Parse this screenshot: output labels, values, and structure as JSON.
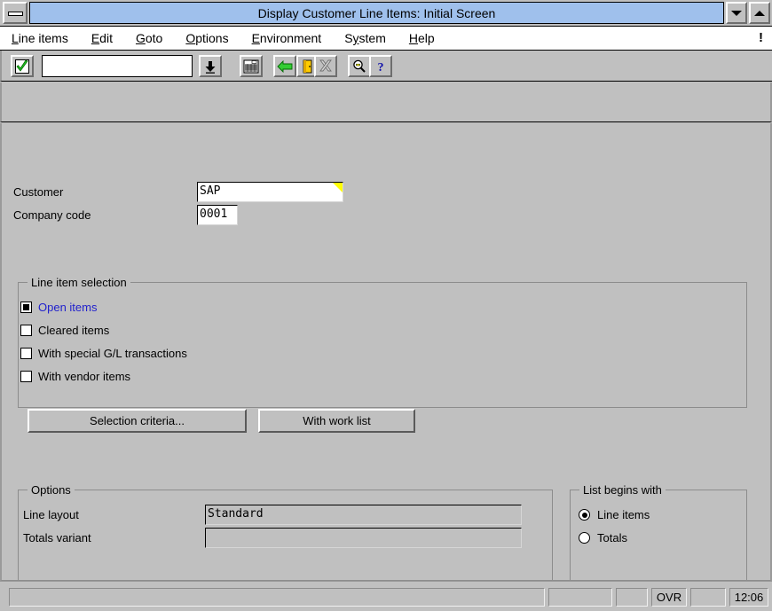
{
  "window": {
    "title": "Display Customer Line Items: Initial Screen",
    "sysmenu_icon": "system-menu-icon",
    "minimize_icon": "minimize-icon",
    "maximize_icon": "maximize-icon"
  },
  "menubar": {
    "items": [
      {
        "label": "Line items",
        "accel": "L"
      },
      {
        "label": "Edit",
        "accel": "E"
      },
      {
        "label": "Goto",
        "accel": "G"
      },
      {
        "label": "Options",
        "accel": "O"
      },
      {
        "label": "Environment",
        "accel": "E"
      },
      {
        "label": "System",
        "accel": "y"
      },
      {
        "label": "Help",
        "accel": "H"
      }
    ],
    "indicator": "!"
  },
  "toolbar": {
    "enter_icon": "green-check-enter-icon",
    "command_field": {
      "value": "",
      "placeholder": ""
    },
    "command_dropdown_icon": "chevron-down-icon",
    "save_icon": "save-icon",
    "back_icon": "green-back-arrow-icon",
    "exit_icon": "exit-door-icon",
    "cancel_icon": "cancel-x-icon",
    "find_icon": "magnifier-find-icon",
    "help_icon": "question-mark-help-icon"
  },
  "form": {
    "customer": {
      "label": "Customer",
      "value": "SAP",
      "has_value_help": true
    },
    "company_code": {
      "label": "Company code",
      "value": "0001"
    }
  },
  "line_item_selection": {
    "title": "Line item selection",
    "checkboxes": [
      {
        "label": "Open items",
        "checked": true,
        "highlight": true
      },
      {
        "label": "Cleared items",
        "checked": false,
        "highlight": false
      },
      {
        "label": "With special G/L transactions",
        "checked": false,
        "highlight": false
      },
      {
        "label": "With vendor items",
        "checked": false,
        "highlight": false
      }
    ],
    "buttons": [
      {
        "label": "Selection criteria..."
      },
      {
        "label": "With work list"
      }
    ]
  },
  "options": {
    "title": "Options",
    "line_layout": {
      "label": "Line layout",
      "value": "Standard"
    },
    "totals_variant": {
      "label": "Totals variant",
      "value": ""
    }
  },
  "list_begins_with": {
    "title": "List begins with",
    "radios": [
      {
        "label": "Line items",
        "selected": true
      },
      {
        "label": "Totals",
        "selected": false
      }
    ]
  },
  "statusbar": {
    "message": "",
    "segment_a": "",
    "segment_b": "",
    "insert_mode": "OVR",
    "segment_c": "",
    "time": "12:06"
  },
  "colors": {
    "face": "#c0c0c0",
    "title_active": "#9fc0ec",
    "selected_text": "#2222cc",
    "value_help": "#ffff00",
    "field_bg": "#ffffff"
  }
}
